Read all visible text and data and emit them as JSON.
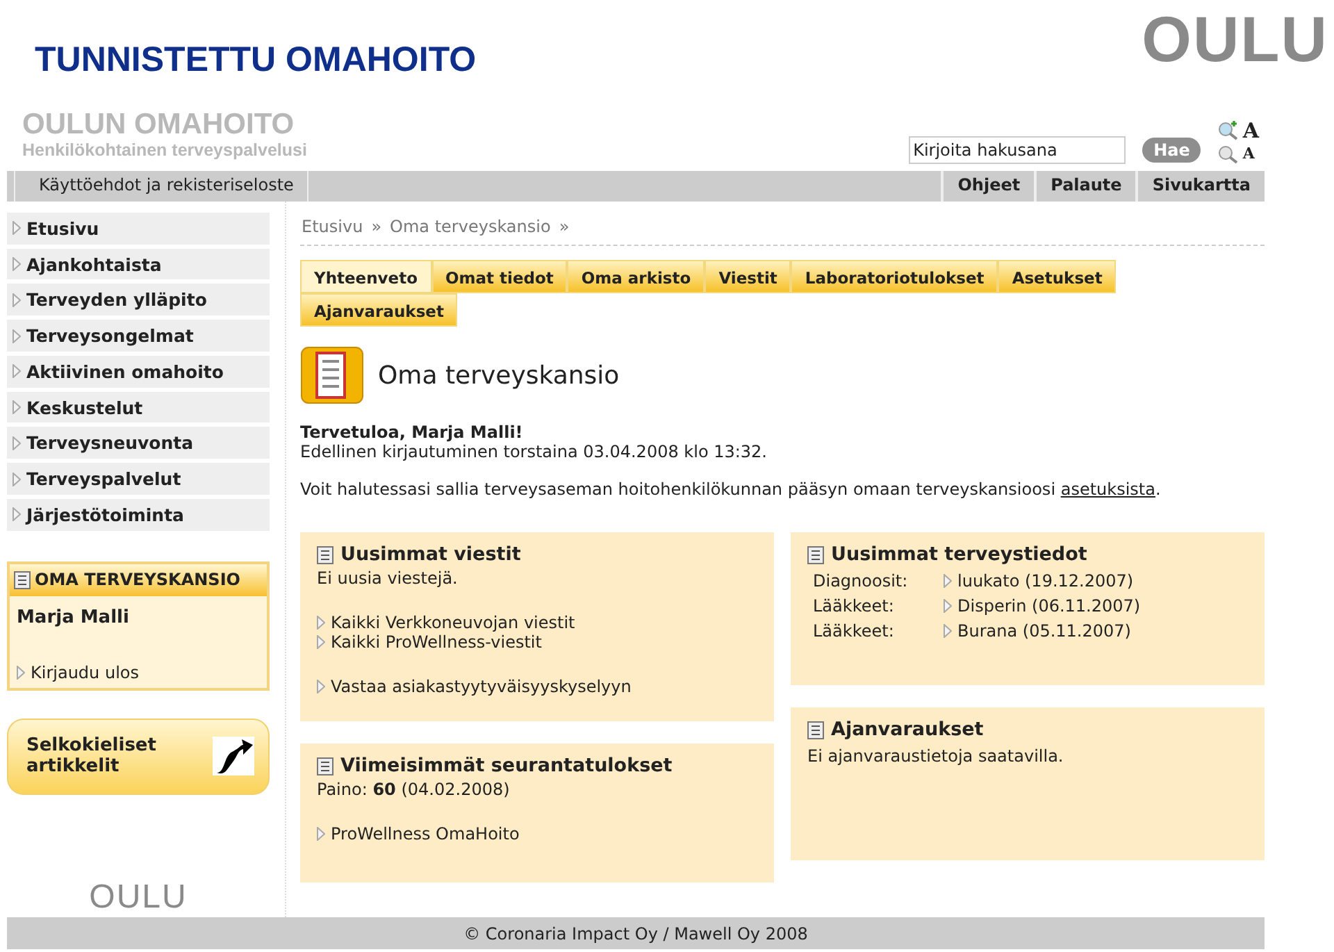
{
  "slide": {
    "title": "TUNNISTETTU OMAHOITO",
    "logo": "OULU"
  },
  "site": {
    "name": "OULUN OMAHOITO",
    "tagline": "Henkilökohtainen terveyspalvelusi"
  },
  "search": {
    "placeholder": "Kirjoita hakusana",
    "button": "Hae"
  },
  "font_size": [
    {
      "label": "A",
      "kind": "larger"
    },
    {
      "label": "A",
      "kind": "smaller"
    }
  ],
  "top_bar": {
    "left": [
      "Käyttöehdot ja rekisteriseloste"
    ],
    "right": [
      "Ohjeet",
      "Palaute",
      "Sivukartta"
    ]
  },
  "sidebar": {
    "items": [
      "Etusivu",
      "Ajankohtaista",
      "Terveyden ylläpito",
      "Terveysongelmat",
      "Aktiivinen omahoito",
      "Keskustelut",
      "Terveysneuvonta",
      "Terveyspalvelut",
      "Järjestötoiminta"
    ]
  },
  "user_box": {
    "title": "OMA TERVEYSKANSIO",
    "name": "Marja Malli",
    "logout": "Kirjaudu ulos"
  },
  "easy_read": {
    "label": "Selkokieliset artikkelit"
  },
  "bottom_logo": "OULU",
  "breadcrumb": [
    "Etusivu",
    "»",
    "Oma terveyskansio",
    "»"
  ],
  "tabs": [
    {
      "label": "Yhteenveto",
      "selected": true
    },
    {
      "label": "Omat tiedot",
      "selected": false
    },
    {
      "label": "Oma arkisto",
      "selected": false
    },
    {
      "label": "Viestit",
      "selected": false
    },
    {
      "label": "Laboratoriotulokset",
      "selected": false
    },
    {
      "label": "Asetukset",
      "selected": false
    },
    {
      "label": "Ajanvaraukset",
      "selected": false
    }
  ],
  "heading": "Oma terveyskansio",
  "welcome": "Tervetuloa, Marja Malli!",
  "last_login": "Edellinen kirjautuminen torstaina 03.04.2008 klo 13:32.",
  "consent": {
    "text": "Voit halutessasi sallia terveysaseman hoitohenkilökunnan pääsyn omaan terveyskansioosi ",
    "link": "asetuksista",
    "end": "."
  },
  "columns": [
    [
      {
        "title": "Uusimmat viestit",
        "sections": [
          [
            {
              "kind": "text",
              "text": "Ei uusia viestejä."
            }
          ],
          [
            {
              "kind": "link",
              "text": "Kaikki Verkkoneuvojan viestit"
            },
            {
              "kind": "link",
              "text": "Kaikki ProWellness-viestit"
            }
          ],
          [
            {
              "kind": "link",
              "text": "Vastaa asiakastyytyväisyyskyselyyn"
            }
          ]
        ]
      },
      {
        "title": "Viimeisimmät seurantatulokset",
        "sections": [
          [
            {
              "kind": "text",
              "text": "Paino: **60** (04.02.2008)"
            }
          ],
          [
            {
              "kind": "link",
              "text": "ProWellness OmaHoito"
            }
          ]
        ]
      }
    ],
    [
      {
        "title": "Uusimmat terveystiedot",
        "sections": [
          [
            {
              "kind": "row",
              "label": "Diagnoosit:",
              "text": "luukato (19.12.2007)"
            },
            {
              "kind": "row",
              "label": "Lääkkeet:",
              "text": "Disperin (06.11.2007)"
            },
            {
              "kind": "row",
              "label": "Lääkkeet:",
              "text": "Burana (05.11.2007)"
            }
          ]
        ]
      },
      {
        "title": "Ajanvaraukset",
        "sections": [
          [
            {
              "kind": "text",
              "text": "Ei ajanvaraustietoja saatavilla."
            }
          ]
        ]
      }
    ]
  ],
  "footer": "© Coronaria Impact Oy / Mawell Oy 2008"
}
